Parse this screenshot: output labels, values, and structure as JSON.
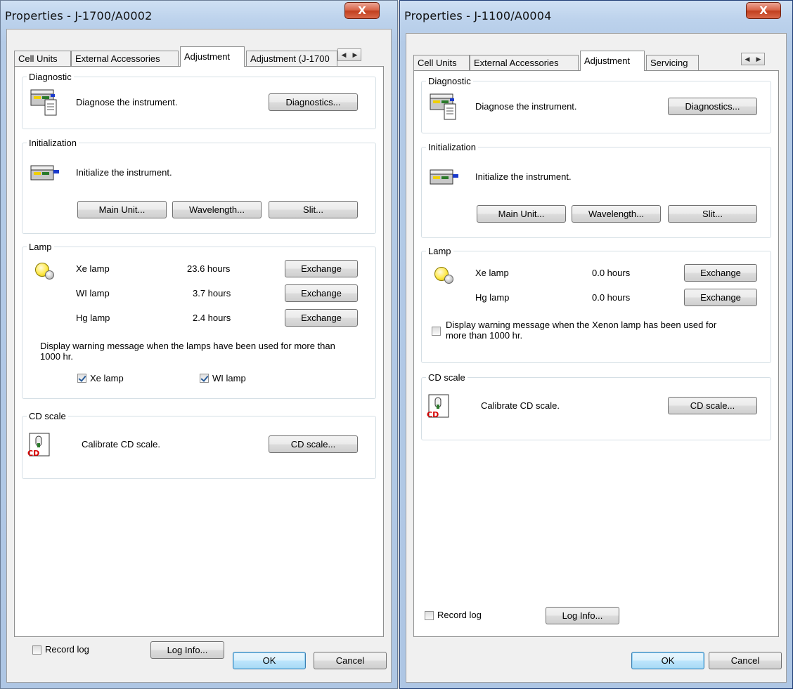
{
  "dialog1": {
    "title": "Properties - J-1700/A0002",
    "close": "X",
    "tabs": [
      "Cell Units",
      "External Accessories",
      "Adjustment",
      "Adjustment (J-1700"
    ],
    "active_tab": "Adjustment",
    "diagnostic": {
      "label": "Diagnostic",
      "text": "Diagnose the instrument.",
      "button": "Diagnostics..."
    },
    "initialization": {
      "label": "Initialization",
      "text": "Initialize the instrument.",
      "main_unit": "Main Unit...",
      "wavelength": "Wavelength...",
      "slit": "Slit..."
    },
    "lamp": {
      "label": "Lamp",
      "rows": [
        {
          "name": "Xe lamp",
          "hours": "23.6 hours",
          "button": "Exchange"
        },
        {
          "name": "WI lamp",
          "hours": "3.7 hours",
          "button": "Exchange"
        },
        {
          "name": "Hg lamp",
          "hours": "2.4 hours",
          "button": "Exchange"
        }
      ],
      "warning": "Display warning message when the lamps have been used for more than 1000 hr.",
      "check_xe": "Xe lamp",
      "check_wi": "WI lamp"
    },
    "cd_scale": {
      "label": "CD scale",
      "text": "Calibrate CD scale.",
      "button": "CD scale..."
    },
    "record_log": "Record log",
    "log_info": "Log Info...",
    "ok": "OK",
    "cancel": "Cancel"
  },
  "dialog2": {
    "title": "Properties - J-1100/A0004",
    "close": "X",
    "tabs": [
      "Cell Units",
      "External Accessories",
      "Adjustment",
      "Servicing"
    ],
    "active_tab": "Adjustment",
    "diagnostic": {
      "label": "Diagnostic",
      "text": "Diagnose the instrument.",
      "button": "Diagnostics..."
    },
    "initialization": {
      "label": "Initialization",
      "text": "Initialize the instrument.",
      "main_unit": "Main Unit...",
      "wavelength": "Wavelength...",
      "slit": "Slit..."
    },
    "lamp": {
      "label": "Lamp",
      "rows": [
        {
          "name": "Xe lamp",
          "hours": "0.0 hours",
          "button": "Exchange"
        },
        {
          "name": "Hg lamp",
          "hours": "0.0 hours",
          "button": "Exchange"
        }
      ],
      "warning": "Display warning message when the Xenon lamp has been used for more than 1000 hr."
    },
    "cd_scale": {
      "label": "CD scale",
      "text": "Calibrate CD scale.",
      "button": "CD scale..."
    },
    "record_log": "Record log",
    "log_info": "Log Info...",
    "ok": "OK",
    "cancel": "Cancel"
  },
  "icons": {
    "instrument": "instrument-icon",
    "lamp": "lamp-bulb-icon",
    "cd": "cd-scale-icon",
    "tab_scroll": "tab-scroll-arrows-icon"
  },
  "colors": {
    "window_frame": "#b4cbe7",
    "close_button": "#c2401f",
    "ok_button_border": "#3c7fb1",
    "cd_icon_text": "#d60000"
  }
}
